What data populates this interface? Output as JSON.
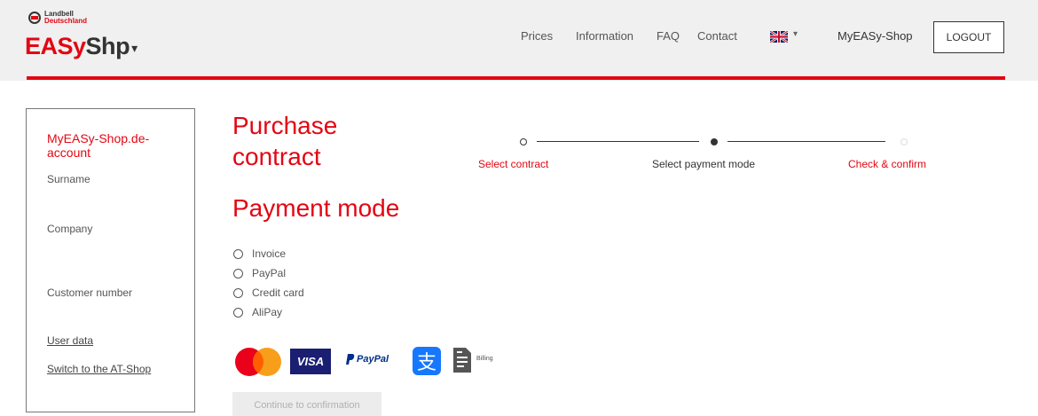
{
  "header": {
    "logo": {
      "small_line1": "Landbell",
      "small_line2": "Deutschland",
      "brand_a": "EASy",
      "brand_b": "Sh",
      "brand_c": "p",
      "caret": "▾"
    },
    "nav": {
      "prices": "Prices",
      "information": "Information",
      "faq": "FAQ",
      "contact": "Contact"
    },
    "language_caret": "▾",
    "my_shop": "MyEASy-Shop",
    "logout": "LOGOUT"
  },
  "sidebar": {
    "title": "MyEASy-Shop.de-account",
    "surname": "Surname",
    "company": "Company",
    "customer_number": "Customer number",
    "user_data": "User data",
    "switch_shop": "Switch to the AT-Shop"
  },
  "main": {
    "heading_purchase": "Purchase contract",
    "heading_payment": "Payment mode",
    "stepper": {
      "steps": [
        {
          "label": "Select contract",
          "state": "done"
        },
        {
          "label": "Select payment mode",
          "state": "active"
        },
        {
          "label": "Check & confirm",
          "state": "pending"
        }
      ]
    },
    "payment_options": [
      "Invoice",
      "PayPal",
      "Credit card",
      "AliPay"
    ],
    "logos": {
      "visa": "VISA",
      "paypal": "PayPal",
      "alipay_char": "支",
      "billing": "Billing"
    },
    "continue_button": "Continue to confirmation"
  },
  "colors": {
    "accent": "#e30613",
    "header_bg": "#f0f0f0",
    "disabled_bg": "#ececec"
  }
}
